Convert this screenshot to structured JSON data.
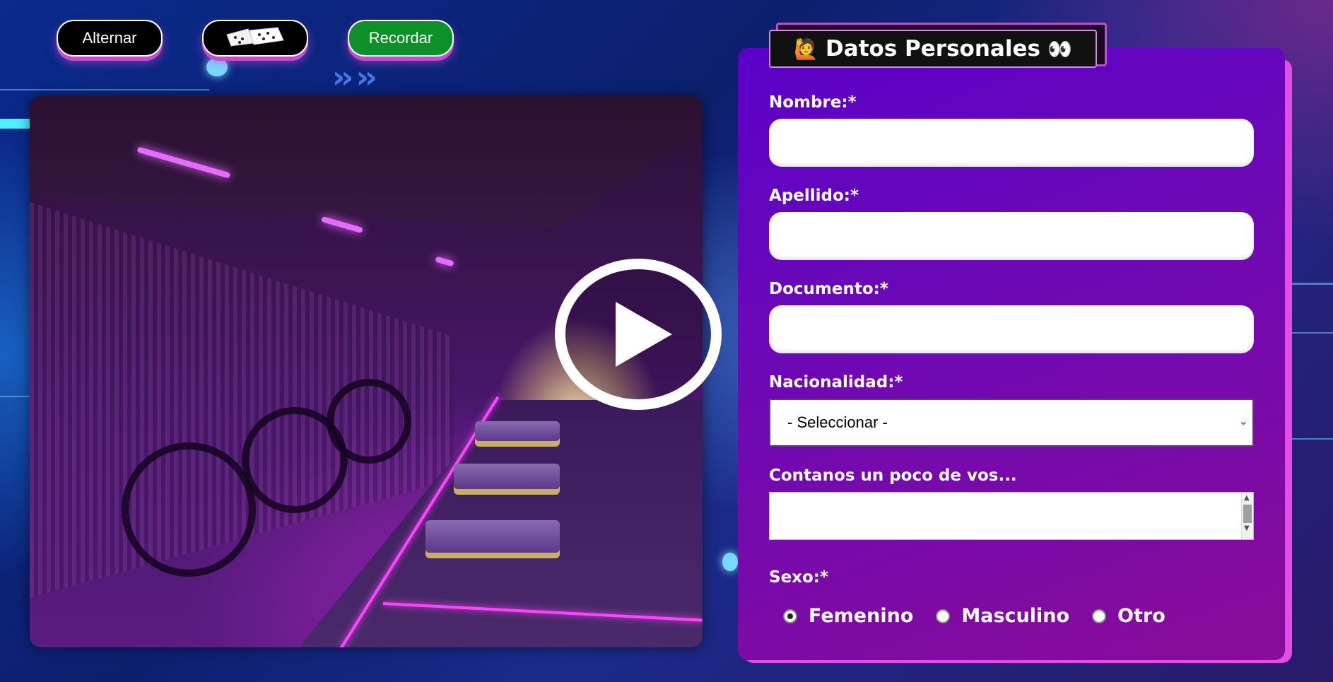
{
  "toolbar": {
    "alternar_label": "Alternar",
    "recordar_label": "Recordar",
    "dice_icon": "dice-icon"
  },
  "video": {
    "play_icon": "play-icon"
  },
  "form": {
    "title": "Datos Personales",
    "title_icon_left": "🙋",
    "title_icon_right": "👀",
    "nombre_label": "Nombre:*",
    "nombre_value": "",
    "apellido_label": "Apellido:*",
    "apellido_value": "",
    "documento_label": "Documento:*",
    "documento_value": "",
    "nacionalidad_label": "Nacionalidad:*",
    "nacionalidad_selected": "- Seleccionar -",
    "contanos_label": "Contanos un poco de vos...",
    "contanos_value": "",
    "sexo_label": "Sexo:*",
    "sexo_options": [
      "Femenino",
      "Masculino",
      "Otro"
    ],
    "sexo_selected": "Femenino"
  },
  "colors": {
    "accent_pink": "#e14de6",
    "form_purple": "#6a08b8",
    "recordar_green": "#0d8f2a"
  }
}
